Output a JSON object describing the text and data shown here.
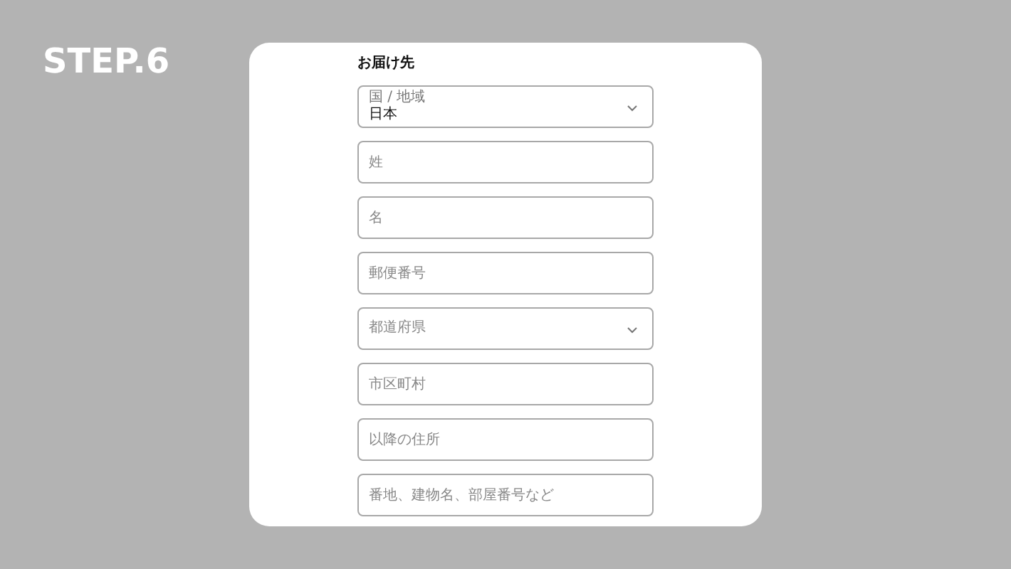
{
  "step_title": "STEP.6",
  "form": {
    "title": "お届け先",
    "fields": [
      {
        "kind": "select",
        "label": "国 / 地域",
        "value": "日本"
      },
      {
        "kind": "text",
        "placeholder": "姓"
      },
      {
        "kind": "text",
        "placeholder": "名"
      },
      {
        "kind": "text",
        "placeholder": "郵便番号"
      },
      {
        "kind": "select",
        "placeholder": "都道府県"
      },
      {
        "kind": "text",
        "placeholder": "市区町村"
      },
      {
        "kind": "text",
        "placeholder": "以降の住所"
      },
      {
        "kind": "text",
        "placeholder": "番地、建物名、部屋番号など"
      }
    ]
  }
}
